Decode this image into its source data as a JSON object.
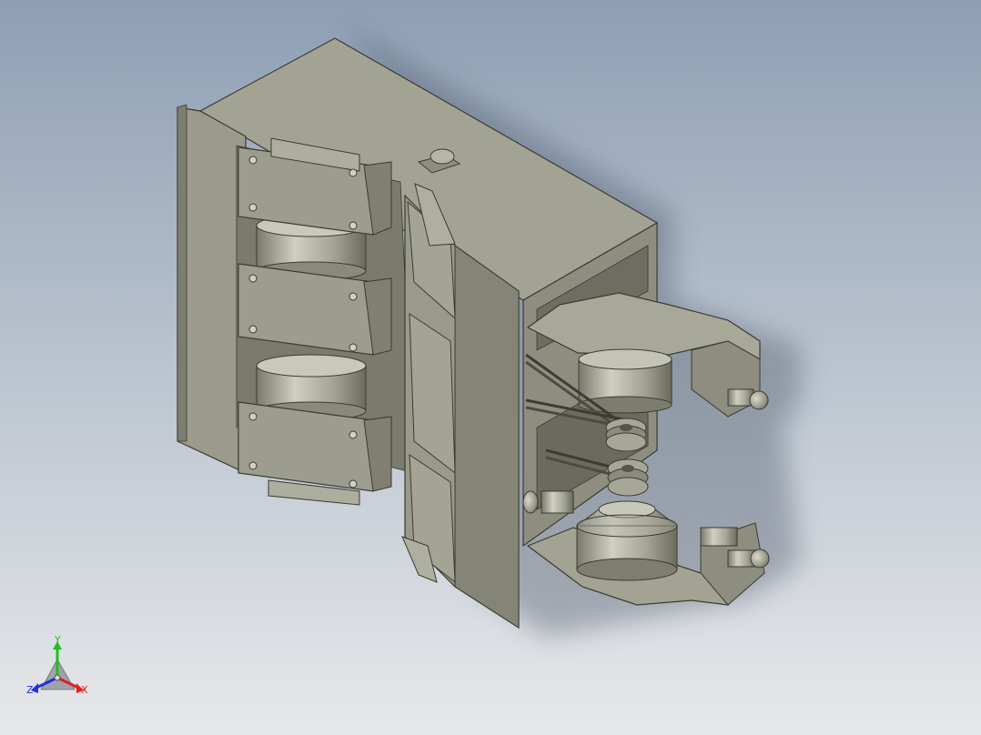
{
  "viewport": {
    "background_top": "#8e9fb4",
    "background_bottom": "#e7e8ea"
  },
  "model": {
    "body_color": "#9a9a8a",
    "body_dark": "#6f6f63",
    "body_light": "#b5b5a6"
  },
  "triad": {
    "axes": [
      {
        "name": "Y",
        "label": "Y",
        "color": "#1fbf1f"
      },
      {
        "name": "X",
        "label": "X",
        "color": "#e02020"
      },
      {
        "name": "Z",
        "label": "Z",
        "color": "#2030e0"
      }
    ]
  }
}
